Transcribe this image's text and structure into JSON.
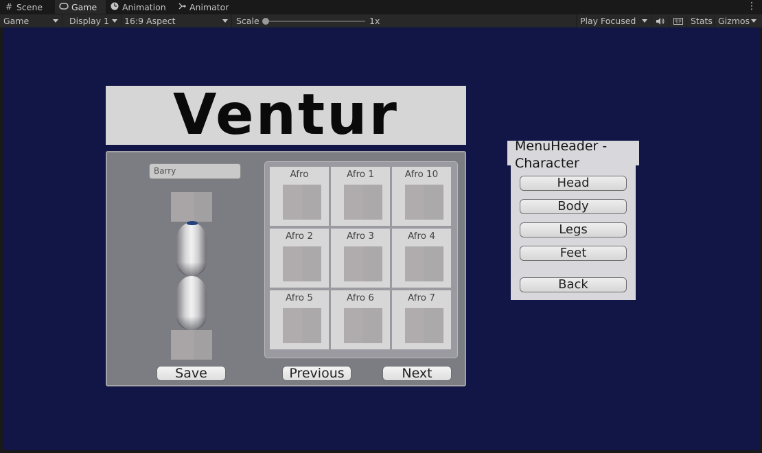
{
  "tabs": [
    {
      "label": "Scene",
      "icon": "grid-icon"
    },
    {
      "label": "Game",
      "icon": "gamepad-icon"
    },
    {
      "label": "Animation",
      "icon": "clock-icon"
    },
    {
      "label": "Animator",
      "icon": "animator-icon"
    }
  ],
  "toolbar": {
    "view_select": "Game",
    "display_select": "Display 1",
    "aspect_select": "16:9 Aspect",
    "scale_label": "Scale",
    "scale_value": "1x",
    "play_mode": "Play Focused",
    "stats_label": "Stats",
    "gizmos_label": "Gizmos"
  },
  "game": {
    "title": "Ventur",
    "name_value": "Barry",
    "save_label": "Save",
    "previous_label": "Previous",
    "next_label": "Next",
    "hair_options": [
      "Afro",
      "Afro 1",
      "Afro 10",
      "Afro 2",
      "Afro 3",
      "Afro 4",
      "Afro 5",
      "Afro 6",
      "Afro 7"
    ],
    "menu_header": "MenuHeader - Character",
    "menu_items": [
      "Head",
      "Body",
      "Legs",
      "Feet"
    ],
    "back_label": "Back"
  },
  "colors": {
    "background": "#111646",
    "editor_dark": "#191919",
    "toolbar": "#282828",
    "panel": "#7c7c83",
    "hair_accent": "#23407a"
  }
}
